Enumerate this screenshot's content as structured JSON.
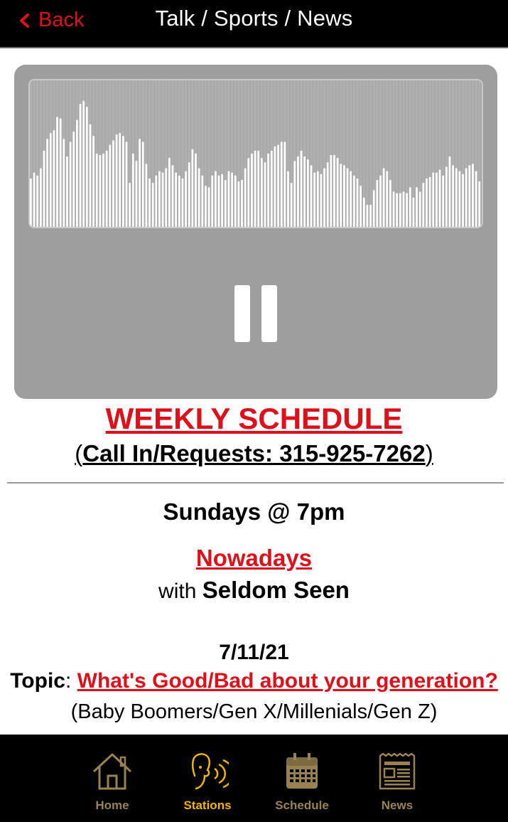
{
  "header": {
    "back_label": "Back",
    "title": "Talk / Sports / News"
  },
  "player": {
    "state": "playing",
    "visualizer_levels": [
      0.33,
      0.37,
      0.35,
      0.4,
      0.52,
      0.6,
      0.64,
      0.66,
      0.75,
      0.74,
      0.6,
      0.48,
      0.58,
      0.65,
      0.73,
      0.84,
      0.86,
      0.82,
      0.7,
      0.62,
      0.5,
      0.49,
      0.5,
      0.52,
      0.56,
      0.59,
      0.63,
      0.64,
      0.62,
      0.58,
      0.3,
      0.5,
      0.45,
      0.6,
      0.58,
      0.43,
      0.33,
      0.3,
      0.35,
      0.38,
      0.37,
      0.4,
      0.47,
      0.42,
      0.37,
      0.35,
      0.33,
      0.38,
      0.44,
      0.53,
      0.5,
      0.4,
      0.35,
      0.28,
      0.27,
      0.35,
      0.38,
      0.35,
      0.36,
      0.32,
      0.38,
      0.37,
      0.35,
      0.31,
      0.32,
      0.4,
      0.47,
      0.5,
      0.52,
      0.52,
      0.47,
      0.44,
      0.5,
      0.52,
      0.55,
      0.56,
      0.58,
      0.58,
      0.38,
      0.3,
      0.45,
      0.48,
      0.52,
      0.48,
      0.46,
      0.42,
      0.37,
      0.38,
      0.36,
      0.4,
      0.44,
      0.49,
      0.49,
      0.47,
      0.43,
      0.42,
      0.4,
      0.38,
      0.35,
      0.33,
      0.28,
      0.2,
      0.15,
      0.15,
      0.25,
      0.32,
      0.35,
      0.4,
      0.38,
      0.32,
      0.24,
      0.23,
      0.23,
      0.24,
      0.23,
      0.27,
      0.2,
      0.27,
      0.24,
      0.3,
      0.33,
      0.34,
      0.37,
      0.37,
      0.39,
      0.35,
      0.41,
      0.48,
      0.42,
      0.4,
      0.38,
      0.36,
      0.4,
      0.42,
      0.43,
      0.38,
      0.31
    ],
    "pause_label": "Pause"
  },
  "schedule": {
    "heading": "WEEKLY SCHEDULE",
    "call_in_open": "(",
    "call_in_text": "Call In/Requests: 315-925-7262",
    "call_in_close": ")",
    "day": "Sundays @ 7pm",
    "show_name": "Nowadays",
    "host_prefix": "with ",
    "host_name": "Seldom Seen",
    "date": "7/11/21",
    "topic_label": "Topic",
    "topic_sep": ": ",
    "topic_text": "What's Good/Bad about your generation?",
    "generations": "(Baby Boomers/Gen X/Millenials/Gen Z)"
  },
  "nav": {
    "items": [
      {
        "label": "Home",
        "icon": "home-icon",
        "active": false
      },
      {
        "label": "Stations",
        "icon": "stations-icon",
        "active": true
      },
      {
        "label": "Schedule",
        "icon": "calendar-icon",
        "active": false
      },
      {
        "label": "News",
        "icon": "newspaper-icon",
        "active": false
      }
    ],
    "colors": {
      "active": "#f2b400",
      "inactive": "#9a8250"
    }
  },
  "colors": {
    "accent": "#e0101a",
    "header_bg": "#000000",
    "player_bg": "#9e9e9e"
  }
}
